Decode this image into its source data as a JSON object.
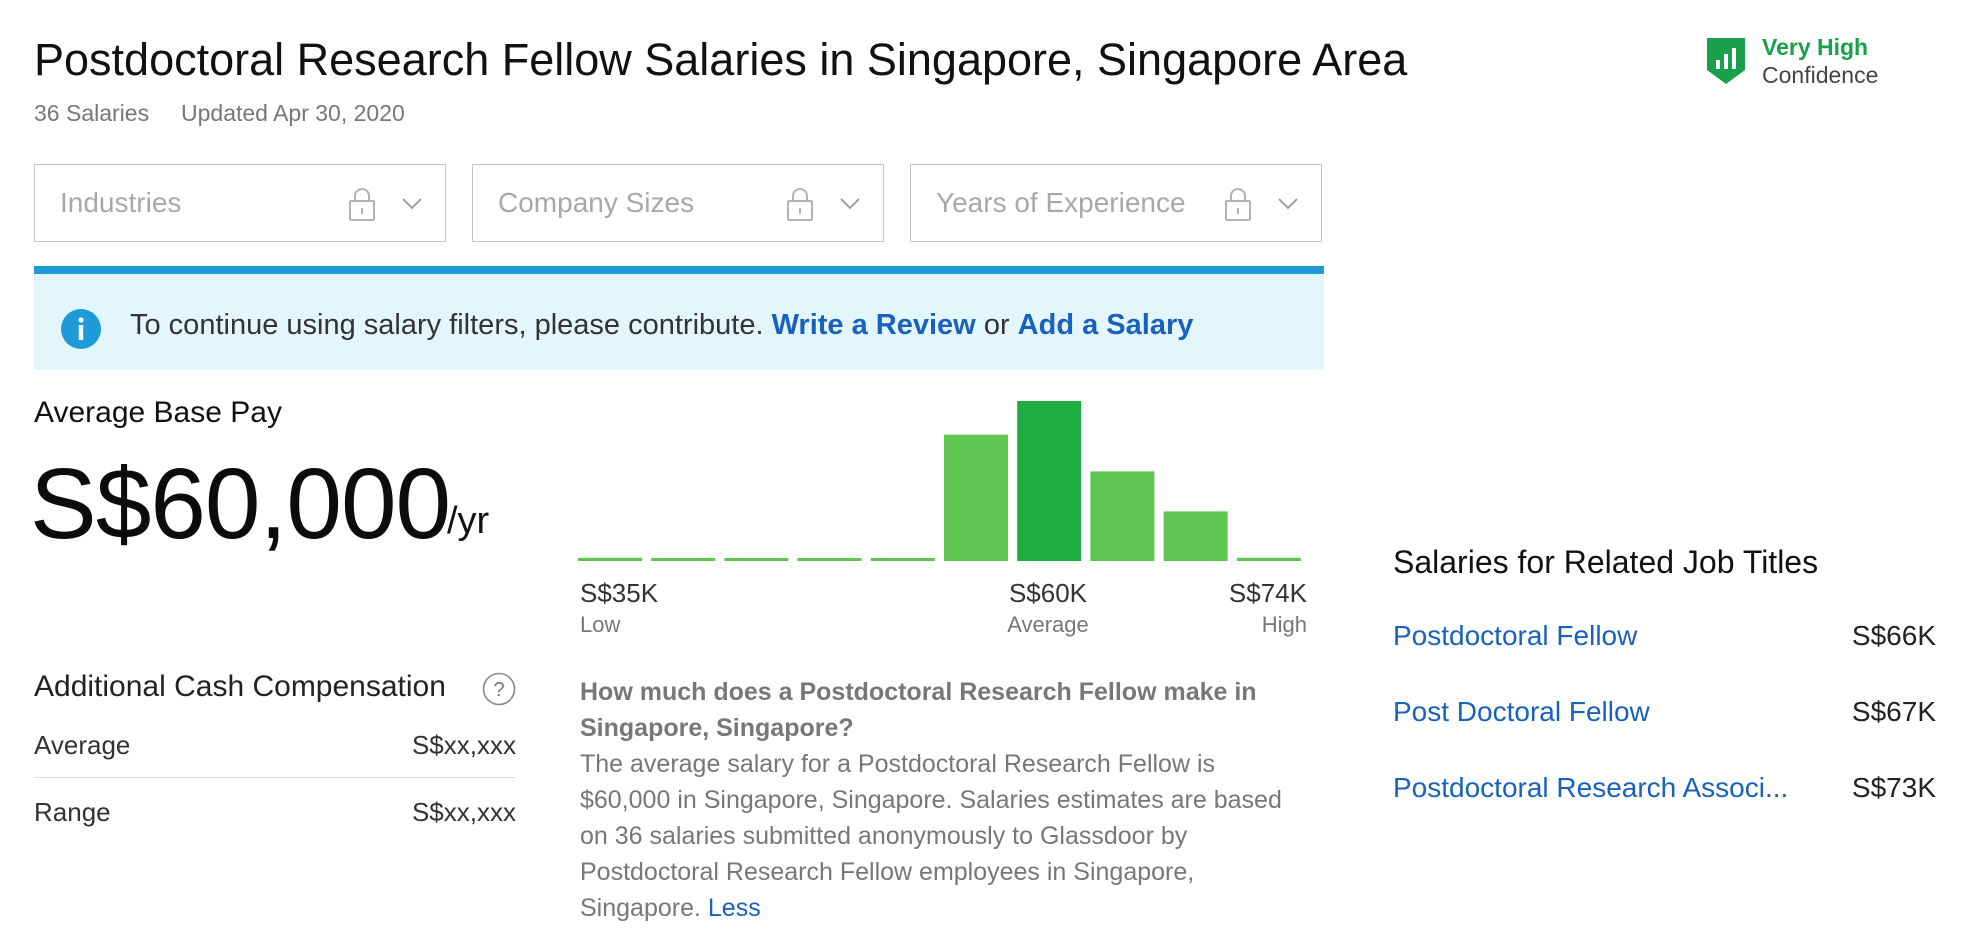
{
  "header": {
    "title": "Postdoctoral Research Fellow Salaries in Singapore, Singapore Area",
    "salary_count": "36 Salaries",
    "updated": "Updated Apr 30, 2020"
  },
  "confidence": {
    "level": "Very High",
    "label": "Confidence",
    "color": "#1aa04a",
    "icon": "shield-chart-icon"
  },
  "filters": [
    {
      "placeholder": "Industries",
      "icons": [
        "lock-icon",
        "chevron-down-icon"
      ]
    },
    {
      "placeholder": "Company Sizes",
      "icons": [
        "lock-icon",
        "chevron-down-icon"
      ]
    },
    {
      "placeholder": "Years of Experience",
      "icons": [
        "lock-icon",
        "chevron-down-icon"
      ]
    }
  ],
  "banner": {
    "icon": "info-icon",
    "text": "To continue using salary filters, please contribute.",
    "link1": "Write a Review",
    "or": "or",
    "link2": "Add a Salary",
    "accent": "#1e9ad6",
    "background": "#e3f6fb"
  },
  "pay": {
    "label": "Average Base Pay",
    "amount": "S$60,000",
    "unit": "/yr"
  },
  "histogram": {
    "bar_color": "#5ec650",
    "average_bar_color": "#1fad42",
    "relative_heights": [
      0.02,
      0.01,
      0.01,
      0.01,
      0.01,
      0.79,
      1.0,
      0.56,
      0.31,
      0.02
    ],
    "average_index": 6,
    "low": {
      "value": "S$35K",
      "label": "Low"
    },
    "average": {
      "value": "S$60K",
      "label": "Average"
    },
    "high": {
      "value": "S$74K",
      "label": "High"
    }
  },
  "additional_cash": {
    "title": "Additional Cash Compensation",
    "help_icon": "question-icon",
    "rows": [
      {
        "label": "Average",
        "value": "S$xx,xxx"
      },
      {
        "label": "Range",
        "value": "S$xx,xxx"
      }
    ]
  },
  "description": {
    "question": "How much does a Postdoctoral Research Fellow make in Singapore, Singapore?",
    "body": "The average salary for a Postdoctoral Research Fellow is $60,000 in Singapore, Singapore. Salaries estimates are based on 36 salaries submitted anonymously to Glassdoor by Postdoctoral Research Fellow employees in Singapore, Singapore.",
    "less_link": "Less"
  },
  "related": {
    "title": "Salaries for Related Job Titles",
    "items": [
      {
        "name": "Postdoctoral Fellow",
        "value": "S$66K"
      },
      {
        "name": "Post Doctoral Fellow",
        "value": "S$67K"
      },
      {
        "name": "Postdoctoral Research Associ...",
        "value": "S$73K"
      }
    ]
  }
}
